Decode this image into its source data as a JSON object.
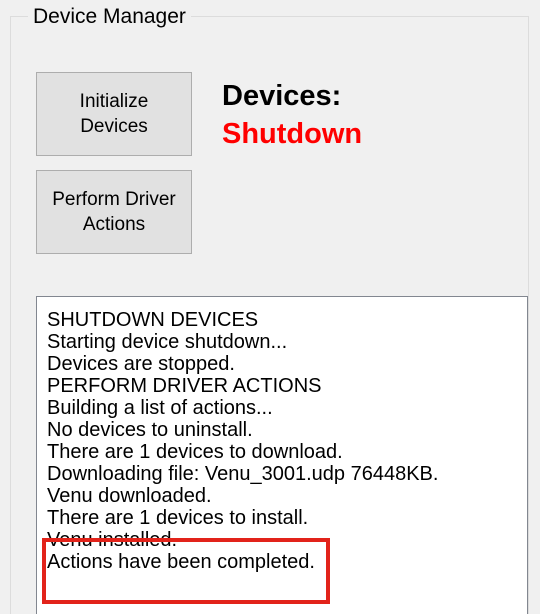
{
  "group": {
    "title": "Device Manager"
  },
  "buttons": {
    "initialize": [
      "Initialize",
      "Devices"
    ],
    "perform_actions": [
      "Perform Driver",
      "Actions"
    ]
  },
  "devices": {
    "label": "Devices:",
    "status": "Shutdown",
    "status_color": "#ff0000"
  },
  "log": {
    "lines": [
      "SHUTDOWN DEVICES",
      "Starting device shutdown...",
      "Devices are stopped.",
      "PERFORM DRIVER ACTIONS",
      "Building a list of actions...",
      "No devices to uninstall.",
      "There are 1 devices to download.",
      "Downloading file: Venu_3001.udp 76448KB.",
      "Venu downloaded.",
      "There are 1 devices to install.",
      "Venu installed.",
      "Actions have been completed."
    ]
  },
  "highlight": {
    "color": "#e2231a"
  }
}
